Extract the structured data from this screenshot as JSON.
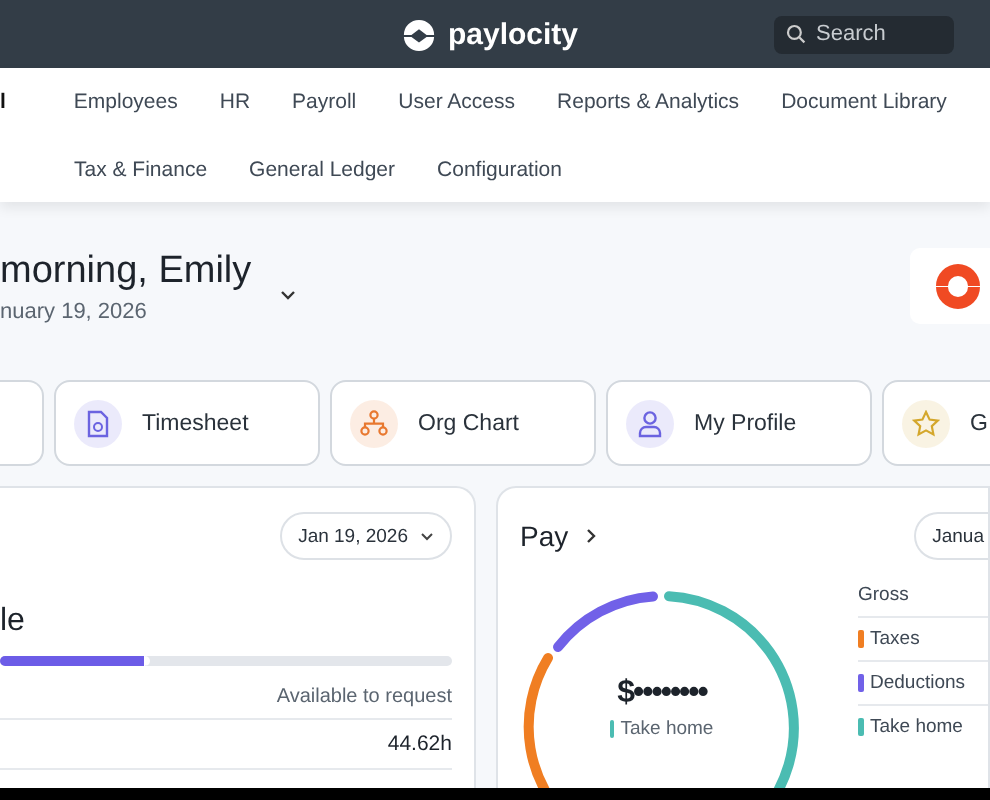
{
  "header": {
    "brand": "paylocity",
    "search": {
      "placeholder": "Search"
    }
  },
  "nav": {
    "items": [
      {
        "label": "l",
        "selected": true
      },
      {
        "label": "Employees",
        "selected": false
      },
      {
        "label": "HR",
        "selected": false
      },
      {
        "label": "Payroll",
        "selected": false
      },
      {
        "label": "User Access",
        "selected": false
      },
      {
        "label": "Reports & Analytics",
        "selected": false
      },
      {
        "label": "Document Library",
        "selected": false
      },
      {
        "label": "Tax & Finance",
        "selected": false
      },
      {
        "label": "General Ledger",
        "selected": false
      },
      {
        "label": "Configuration",
        "selected": false
      }
    ]
  },
  "greeting": {
    "title": "morning, Emily",
    "date": "nuary 19, 2026"
  },
  "quick_links": [
    {
      "label": "Timesheet",
      "color": "#6b63e0"
    },
    {
      "label": "Org Chart",
      "color": "#e8782f"
    },
    {
      "label": "My Profile",
      "color": "#6b63e0"
    },
    {
      "label": "G",
      "color": "#d4a72c"
    }
  ],
  "time_off": {
    "title": "le",
    "date_button": "Jan 19, 2026",
    "level": 0.32,
    "column": "Available to request",
    "rows": [
      "44.62h"
    ]
  },
  "pay": {
    "title": "Pay",
    "date_button": "Janua",
    "amount": "$••••••••",
    "amount_label": "Take home",
    "legend": [
      {
        "label": "Gross"
      },
      {
        "label": "Taxes",
        "color": "#f07e22"
      },
      {
        "label": "Deductions",
        "color": "#7161e8"
      },
      {
        "label": "Take home",
        "color": "#4bbcb2"
      }
    ]
  }
}
